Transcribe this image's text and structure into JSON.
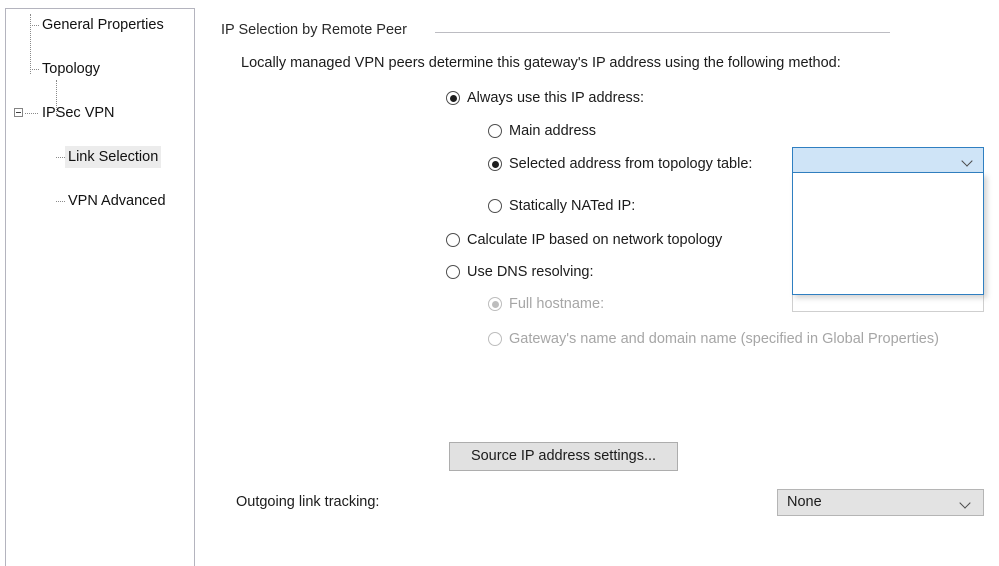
{
  "tree": {
    "items": [
      {
        "label": "General Properties",
        "level": 1,
        "selected": false,
        "expander": false
      },
      {
        "label": "Topology",
        "level": 1,
        "selected": false,
        "expander": false
      },
      {
        "label": "IPSec VPN",
        "level": 1,
        "selected": false,
        "expander": true,
        "expander_state": "expanded"
      },
      {
        "label": "Link Selection",
        "level": 2,
        "selected": true,
        "expander": false
      },
      {
        "label": "VPN Advanced",
        "level": 2,
        "selected": false,
        "expander": false
      }
    ]
  },
  "group": {
    "title": "IP Selection by Remote Peer",
    "description": "Locally managed VPN peers determine this gateway's IP address using the following method:"
  },
  "radios": {
    "always_use": "Always use this IP address:",
    "main_address": "Main address",
    "selected_address": "Selected address from topology table:",
    "statically_nated": "Statically NATed IP:",
    "calculate_ip": "Calculate IP based on network topology",
    "use_dns": "Use DNS resolving:",
    "full_hostname": "Full hostname:",
    "gateway_name": "Gateway's name and domain name (specified in Global Properties)"
  },
  "topology_combo": {
    "value": "",
    "state": "open",
    "options": [],
    "chevron": "chevron-down-icon",
    "highlight_color": "#cfe4f7",
    "border_color": "#2f7fc1"
  },
  "nated_input": {
    "value": ""
  },
  "hostname_input": {
    "value": ""
  },
  "buttons": {
    "source_ip_settings": "Source IP address settings..."
  },
  "link_tracking": {
    "label": "Outgoing link tracking:",
    "value": "None",
    "chevron": "chevron-down-icon"
  }
}
